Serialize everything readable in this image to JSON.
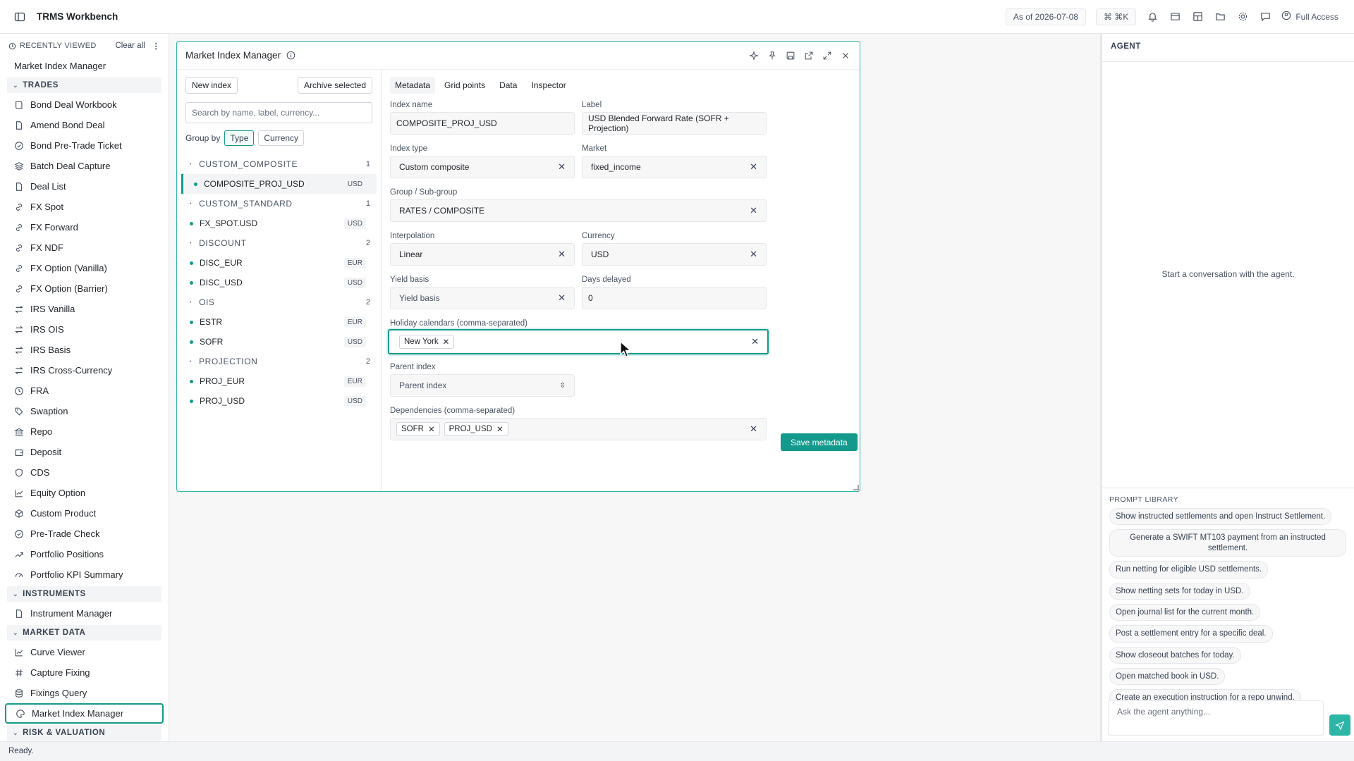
{
  "app": {
    "title": "TRMS Workbench",
    "as_of": "As of 2026-07-08",
    "shortcut": "⌘K",
    "access": "Full Access"
  },
  "sidebar": {
    "recently_viewed_title": "RECENTLY VIEWED",
    "clear_all": "Clear all",
    "recent": [
      "Market Index Manager"
    ],
    "sections": [
      {
        "title": "TRADES",
        "items": [
          {
            "label": "Bond Deal Workbook",
            "icon": "book-icon"
          },
          {
            "label": "Amend Bond Deal",
            "icon": "file-icon"
          },
          {
            "label": "Bond Pre-Trade Ticket",
            "icon": "check-circle-icon"
          },
          {
            "label": "Batch Deal Capture",
            "icon": "layers-icon"
          },
          {
            "label": "Deal List",
            "icon": "file-icon"
          },
          {
            "label": "FX Spot",
            "icon": "link-icon"
          },
          {
            "label": "FX Forward",
            "icon": "link-icon"
          },
          {
            "label": "FX NDF",
            "icon": "link-icon"
          },
          {
            "label": "FX Option (Vanilla)",
            "icon": "link-icon"
          },
          {
            "label": "FX Option (Barrier)",
            "icon": "link-icon"
          },
          {
            "label": "IRS Vanilla",
            "icon": "swap-icon"
          },
          {
            "label": "IRS OIS",
            "icon": "swap-icon"
          },
          {
            "label": "IRS Basis",
            "icon": "swap-icon"
          },
          {
            "label": "IRS Cross-Currency",
            "icon": "swap-icon"
          },
          {
            "label": "FRA",
            "icon": "clock-icon"
          },
          {
            "label": "Swaption",
            "icon": "tag-icon"
          },
          {
            "label": "Repo",
            "icon": "bank-icon"
          },
          {
            "label": "Deposit",
            "icon": "wallet-icon"
          },
          {
            "label": "CDS",
            "icon": "shield-icon"
          },
          {
            "label": "Equity Option",
            "icon": "line-chart-icon"
          },
          {
            "label": "Custom Product",
            "icon": "cube-icon"
          },
          {
            "label": "Pre-Trade Check",
            "icon": "check-circle-icon"
          },
          {
            "label": "Portfolio Positions",
            "icon": "trend-icon"
          },
          {
            "label": "Portfolio KPI Summary",
            "icon": "gauge-icon"
          }
        ]
      },
      {
        "title": "INSTRUMENTS",
        "items": [
          {
            "label": "Instrument Manager",
            "icon": "file-icon"
          }
        ]
      },
      {
        "title": "MARKET DATA",
        "items": [
          {
            "label": "Curve Viewer",
            "icon": "line-chart-icon"
          },
          {
            "label": "Capture Fixing",
            "icon": "hash-icon"
          },
          {
            "label": "Fixings Query",
            "icon": "database-icon"
          },
          {
            "label": "Market Index Manager",
            "icon": "palette-icon"
          }
        ]
      },
      {
        "title": "RISK & VALUATION",
        "items": []
      }
    ]
  },
  "window": {
    "title": "Market Index Manager",
    "new_index": "New index",
    "archive_selected": "Archive selected",
    "search_placeholder": "Search by name, label, currency...",
    "group_by_label": "Group by",
    "group_by_options": [
      "Type",
      "Currency"
    ],
    "groups": [
      {
        "name": "CUSTOM_COMPOSITE",
        "count": "1",
        "items": [
          {
            "name": "COMPOSITE_PROJ_USD",
            "ccy": "USD"
          }
        ]
      },
      {
        "name": "CUSTOM_STANDARD",
        "count": "1",
        "items": [
          {
            "name": "FX_SPOT.USD",
            "ccy": "USD"
          }
        ]
      },
      {
        "name": "DISCOUNT",
        "count": "2",
        "items": [
          {
            "name": "DISC_EUR",
            "ccy": "EUR"
          },
          {
            "name": "DISC_USD",
            "ccy": "USD"
          }
        ]
      },
      {
        "name": "OIS",
        "count": "2",
        "items": [
          {
            "name": "ESTR",
            "ccy": "EUR"
          },
          {
            "name": "SOFR",
            "ccy": "USD"
          }
        ]
      },
      {
        "name": "PROJECTION",
        "count": "2",
        "items": [
          {
            "name": "PROJ_EUR",
            "ccy": "EUR"
          },
          {
            "name": "PROJ_USD",
            "ccy": "USD"
          }
        ]
      }
    ],
    "tabs": [
      "Metadata",
      "Grid points",
      "Data",
      "Inspector"
    ],
    "form": {
      "index_name_label": "Index name",
      "index_name": "COMPOSITE_PROJ_USD",
      "label_label": "Label",
      "label": "USD Blended Forward Rate (SOFR + Projection)",
      "index_type_label": "Index type",
      "index_type": "Custom composite",
      "market_label": "Market",
      "market": "fixed_income",
      "group_label": "Group / Sub-group",
      "group": "RATES / COMPOSITE",
      "interpolation_label": "Interpolation",
      "interpolation": "Linear",
      "currency_label": "Currency",
      "currency": "USD",
      "yield_basis_label": "Yield basis",
      "yield_basis_placeholder": "Yield basis",
      "days_delayed_label": "Days delayed",
      "days_delayed": "0",
      "holiday_label": "Holiday calendars (comma-separated)",
      "holidays": [
        "New York"
      ],
      "parent_label": "Parent index",
      "parent_placeholder": "Parent index",
      "deps_label": "Dependencies (comma-separated)",
      "deps": [
        "SOFR",
        "PROJ_USD"
      ],
      "save": "Save metadata"
    }
  },
  "agent": {
    "title": "AGENT",
    "empty": "Start a conversation with the agent.",
    "prompt_library_title": "PROMPT LIBRARY",
    "prompts": [
      "Show instructed settlements and open Instruct Settlement.",
      "Generate a SWIFT MT103 payment from an instructed settlement.",
      "Run netting for eligible USD settlements.",
      "Show netting sets for today in USD.",
      "Open journal list for the current month.",
      "Post a settlement entry for a specific deal.",
      "Show closeout batches for today.",
      "Open matched book in USD.",
      "Create an execution instruction for a repo unwind."
    ],
    "input_placeholder": "Ask the agent anything..."
  },
  "status": "Ready."
}
